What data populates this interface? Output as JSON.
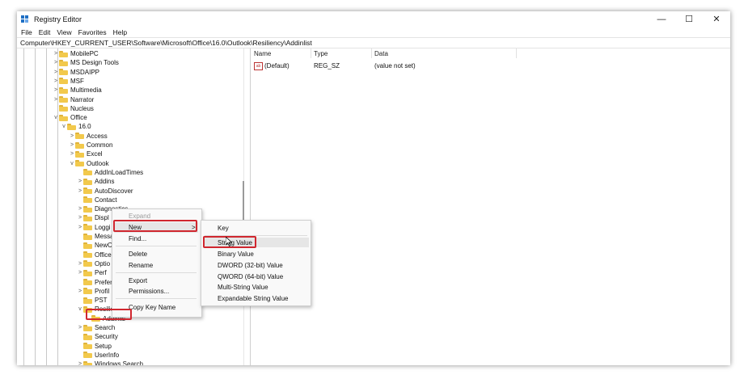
{
  "window": {
    "title": "Registry Editor",
    "minimize": "—",
    "maximize": "☐",
    "close": "✕"
  },
  "menu": [
    "File",
    "Edit",
    "View",
    "Favorites",
    "Help"
  ],
  "address": "Computer\\HKEY_CURRENT_USER\\Software\\Microsoft\\Office\\16.0\\Outlook\\Resiliency\\Addinlist",
  "tree": [
    {
      "label": "MobilePC",
      "chevron": ">"
    },
    {
      "label": "MS Design Tools",
      "chevron": ">"
    },
    {
      "label": "MSDAIPP",
      "chevron": ">"
    },
    {
      "label": "MSF",
      "chevron": ">"
    },
    {
      "label": "Multimedia",
      "chevron": ">"
    },
    {
      "label": "Narrator",
      "chevron": ">"
    },
    {
      "label": "Nucleus",
      "chevron": ""
    },
    {
      "label": "Office",
      "chevron": "v"
    },
    {
      "label": "16.0",
      "chevron": "v"
    },
    {
      "label": "Access",
      "chevron": ">"
    },
    {
      "label": "Common",
      "chevron": ">"
    },
    {
      "label": "Excel",
      "chevron": ">"
    },
    {
      "label": "Outlook",
      "chevron": "v"
    },
    {
      "label": "AddInLoadTimes",
      "chevron": ""
    },
    {
      "label": "Addins",
      "chevron": ">"
    },
    {
      "label": "AutoDiscover",
      "chevron": ">"
    },
    {
      "label": "Contact",
      "chevron": ""
    },
    {
      "label": "Diagnostics",
      "chevron": ">"
    },
    {
      "label": "Displ",
      "chevron": ">"
    },
    {
      "label": "Loggi",
      "chevron": ">"
    },
    {
      "label": "Messa",
      "chevron": ""
    },
    {
      "label": "NewC",
      "chevron": ""
    },
    {
      "label": "Office",
      "chevron": ""
    },
    {
      "label": "Optio",
      "chevron": ">"
    },
    {
      "label": "Perf",
      "chevron": ">"
    },
    {
      "label": "Prefer",
      "chevron": ""
    },
    {
      "label": "Profil",
      "chevron": ">"
    },
    {
      "label": "PST",
      "chevron": ""
    },
    {
      "label": "Resilie",
      "chevron": "v"
    },
    {
      "label": "Addinlis",
      "chevron": ""
    },
    {
      "label": "Search",
      "chevron": ">"
    },
    {
      "label": "Security",
      "chevron": ""
    },
    {
      "label": "Setup",
      "chevron": ""
    },
    {
      "label": "UserInfo",
      "chevron": ""
    },
    {
      "label": "Windows Search",
      "chevron": ">"
    }
  ],
  "list": {
    "headers": {
      "name": "Name",
      "type": "Type",
      "data": "Data"
    },
    "rows": [
      {
        "name": "(Default)",
        "type": "REG_SZ",
        "data": "(value not set)",
        "icon": "ab"
      }
    ]
  },
  "context_menu": [
    "Expand",
    "New",
    "Find...",
    "Delete",
    "Rename",
    "Export",
    "Permissions...",
    "Copy Key Name"
  ],
  "submenu_arrow": ">",
  "new_submenu": [
    "Key",
    "String Value",
    "Binary Value",
    "DWORD (32-bit) Value",
    "QWORD (64-bit) Value",
    "Multi-String Value",
    "Expandable String Value"
  ],
  "colors": {
    "highlight": "#d0272f",
    "folder": "#f2c94c",
    "accent": "#1f6fc4"
  }
}
